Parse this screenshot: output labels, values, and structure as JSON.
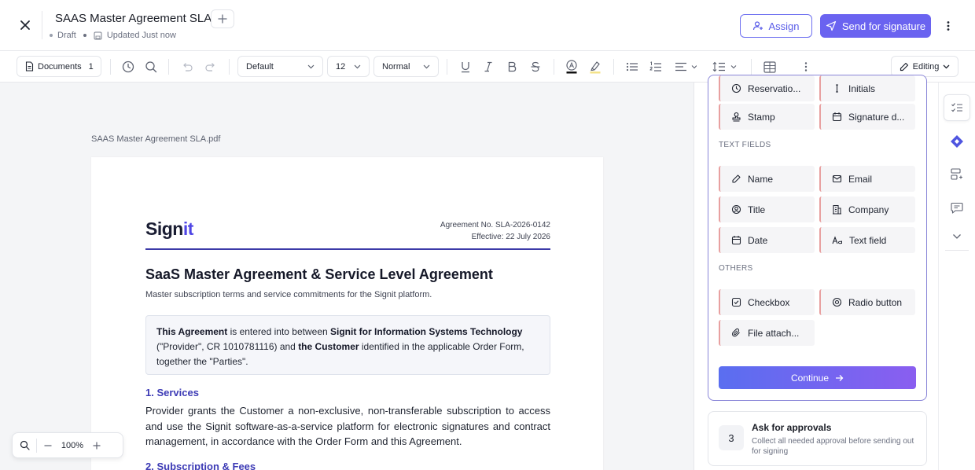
{
  "header": {
    "title": "SAAS Master Agreement SLA",
    "status": "Draft",
    "updated": "Updated Just now",
    "assign_label": "Assign",
    "send_label": "Send for signature"
  },
  "toolbar": {
    "documents_label": "Documents",
    "documents_count": "1",
    "font_family": "Default",
    "font_size": "12",
    "paragraph_style": "Normal",
    "mode": "Editing"
  },
  "document": {
    "file_name": "SAAS Master Agreement SLA.pdf",
    "logo_main": "Sign",
    "logo_accent": "it",
    "agreement_no": "Agreement No. SLA-2026-0142",
    "effective": "Effective: 22 July 2026",
    "heading": "SaaS Master Agreement & Service Level Agreement",
    "subtitle": "Master subscription terms and service commitments for the Signit platform.",
    "intro": {
      "p1_bold": "This Agreement",
      "p2": " is entered into between ",
      "p3_bold": "Signit for Information Systems Technology",
      "p4": " (\"Provider\", CR 1010781116) and ",
      "p5_bold": "the Customer",
      "p6": " identified in the applicable Order Form, together the \"Parties\"."
    },
    "section1_title": "1. Services",
    "section1_text": "Provider grants the Customer a non-exclusive, non-transferable subscription to access and use the Signit software-as-a-service platform for electronic signatures and contract management, in accordance with the Order Form and this Agreement.",
    "section2_title": "2. Subscription & Fees"
  },
  "zoom": {
    "level": "100%"
  },
  "fields_panel": {
    "top_fields": [
      "Reservatio...",
      "Initials",
      "Stamp",
      "Signature d..."
    ],
    "text_fields_label": "TEXT FIELDS",
    "text_fields": [
      "Name",
      "Email",
      "Title",
      "Company",
      "Date",
      "Text field"
    ],
    "others_label": "OTHERS",
    "others": [
      "Checkbox",
      "Radio button",
      "File attach..."
    ],
    "continue_label": "Continue"
  },
  "approval": {
    "step": "3",
    "title": "Ask for approvals",
    "description": "Collect all needed approval before sending out for signing"
  }
}
